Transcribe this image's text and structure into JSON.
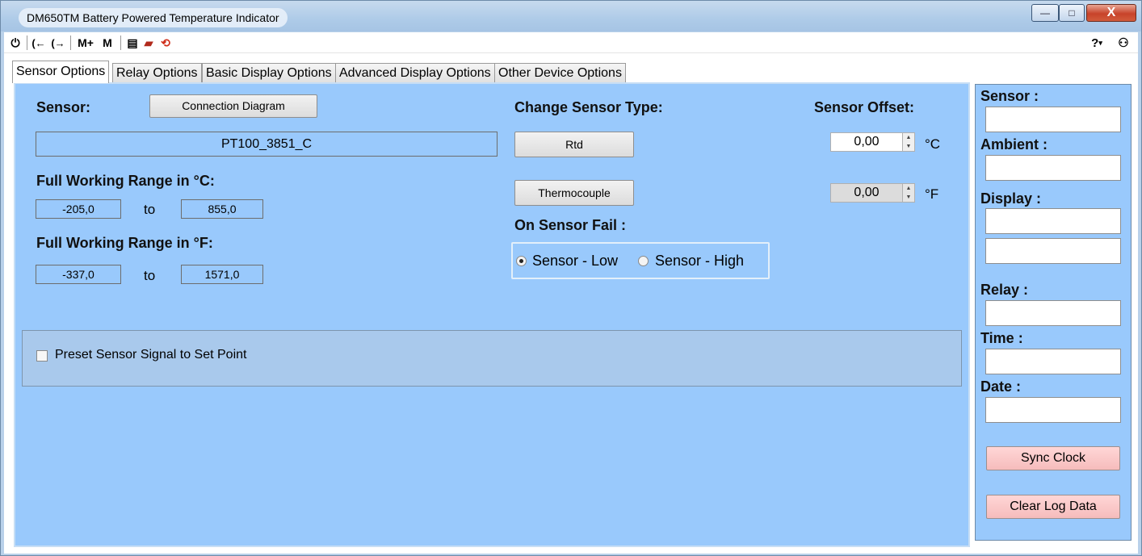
{
  "window": {
    "title": "DM650TM Battery Powered Temperature Indicator",
    "caption_buttons": {
      "minimize": "—",
      "maximize": "□",
      "close": "X"
    }
  },
  "toolbar": {
    "items": [
      {
        "icon": "power-icon",
        "glyph": "⏻"
      },
      {
        "icon": "connect-in-icon",
        "glyph": "(←"
      },
      {
        "icon": "connect-out-icon",
        "glyph": "(→"
      },
      {
        "icon": "memory-plus-icon",
        "label": "M+"
      },
      {
        "icon": "memory-icon",
        "label": "M"
      },
      {
        "icon": "save-icon",
        "glyph": "▤"
      },
      {
        "icon": "open-folder-icon",
        "glyph": "▰"
      },
      {
        "icon": "refresh-icon",
        "glyph": "⟲"
      }
    ],
    "help_glyph": "?",
    "user_glyph": "⚇"
  },
  "tabs": [
    {
      "label": "Sensor Options",
      "active": true
    },
    {
      "label": "Relay Options",
      "active": false
    },
    {
      "label": "Basic Display Options",
      "active": false
    },
    {
      "label": "Advanced Display Options",
      "active": false
    },
    {
      "label": "Other Device Options",
      "active": false
    }
  ],
  "sensor_options": {
    "sensor_label": "Sensor:",
    "connection_diagram_button": "Connection Diagram",
    "sensor_value": "PT100_3851_C",
    "range_c_label": "Full Working Range in °C:",
    "range_c_min": "-205,0",
    "range_c_to": "to",
    "range_c_max": "855,0",
    "range_f_label": "Full Working Range in °F:",
    "range_f_min": "-337,0",
    "range_f_to": "to",
    "range_f_max": "1571,0",
    "change_type_label": "Change Sensor Type:",
    "rtd_button": "Rtd",
    "thermocouple_button": "Thermocouple",
    "offset_label": "Sensor Offset:",
    "offset_c_value": "0,00",
    "offset_c_unit": "°C",
    "offset_f_value": "0,00",
    "offset_f_unit": "°F",
    "fail_label": "On Sensor Fail :",
    "fail_low_label": "Sensor - Low",
    "fail_high_label": "Sensor - High",
    "fail_selected": "low",
    "preset_label": "Preset Sensor Signal to Set Point",
    "preset_checked": false
  },
  "side_panel": {
    "sensor_label": "Sensor :",
    "ambient_label": "Ambient :",
    "display_label": "Display :",
    "relay_label": "Relay :",
    "time_label": "Time :",
    "date_label": "Date :",
    "sync_clock_button": "Sync Clock",
    "clear_log_button": "Clear Log Data"
  }
}
